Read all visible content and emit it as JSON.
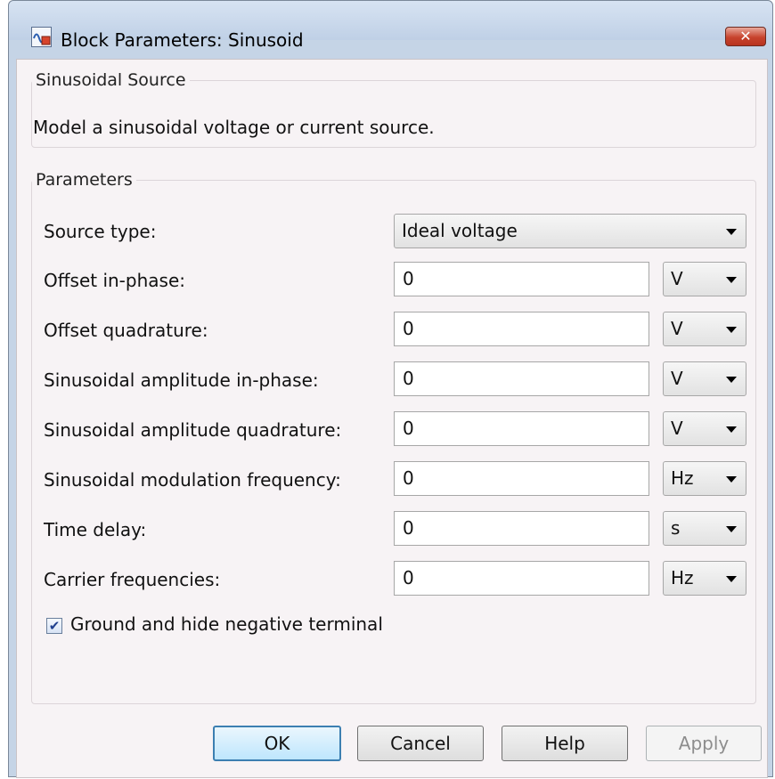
{
  "window": {
    "title": "Block Parameters: Sinusoid",
    "close_glyph": "✕"
  },
  "source_group": {
    "legend": "Sinusoidal Source",
    "description": "Model a sinusoidal voltage or current source."
  },
  "parameters": {
    "legend": "Parameters",
    "source_type": {
      "label": "Source type:",
      "value": "Ideal voltage"
    },
    "rows": [
      {
        "label": "Offset in-phase:",
        "value": "0",
        "unit": "V"
      },
      {
        "label": "Offset quadrature:",
        "value": "0",
        "unit": "V"
      },
      {
        "label": "Sinusoidal amplitude in-phase:",
        "value": "0",
        "unit": "V"
      },
      {
        "label": "Sinusoidal amplitude quadrature:",
        "value": "0",
        "unit": "V"
      },
      {
        "label": "Sinusoidal modulation frequency:",
        "value": "0",
        "unit": "Hz"
      },
      {
        "label": "Time delay:",
        "value": "0",
        "unit": "s"
      },
      {
        "label": "Carrier frequencies:",
        "value": "0",
        "unit": "Hz"
      }
    ],
    "ground_checkbox": {
      "label": "Ground and hide negative terminal",
      "checked": true,
      "glyph": "✔"
    }
  },
  "buttons": {
    "ok": "OK",
    "cancel": "Cancel",
    "help": "Help",
    "apply": "Apply"
  },
  "colors": {
    "title_bar": "#c5d4e6",
    "close_button": "#c7432d",
    "client_bg": "#f7f3f5",
    "default_button_border": "#3c7fb1"
  }
}
